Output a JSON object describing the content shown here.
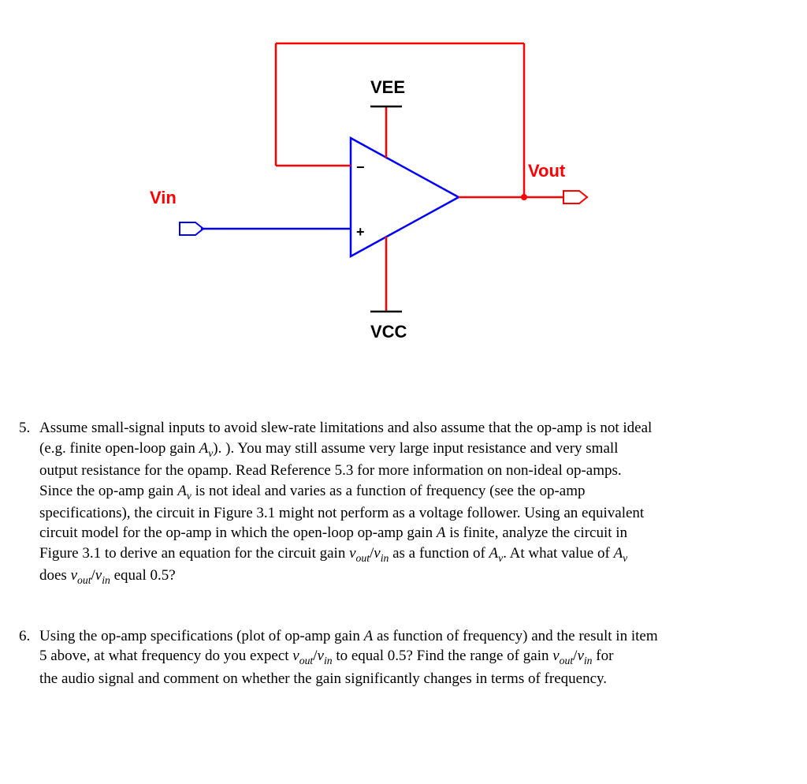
{
  "diagram": {
    "vee_label": "VEE",
    "vcc_label": "VCC",
    "vin_label": "Vin",
    "vout_label": "Vout",
    "plus_sign": "+",
    "minus_sign": "−"
  },
  "problem5": {
    "number": "5.",
    "line1": "Assume small-signal inputs to avoid slew-rate limitations and also assume that the op-amp is not ideal",
    "line2a": "(e.g. finite open-loop gain ",
    "line2_sym1": "A",
    "line2_sub1": "v",
    "line2b": "). ). You may still assume very large input resistance and very small",
    "line3": "output resistance for the opamp. Read Reference 5.3 for more information on non-ideal op-amps.",
    "line4a": "Since the op-amp gain ",
    "line4_sym1": "A",
    "line4_sub1": "v",
    "line4b": " is not ideal and varies as a function of frequency (see the op-amp",
    "line5": "specifications), the circuit in Figure 3.1 might not perform as a voltage follower.  Using an equivalent",
    "line6a": "circuit model for the op-amp in which the open-loop op-amp gain ",
    "line6_symA": "A",
    "line6b": " is finite, analyze the circuit in",
    "line7a": "Figure 3.1 to derive an equation for the circuit gain ",
    "line7_vout": "v",
    "line7_vout_sub": "out",
    "line7_slash": "/",
    "line7_vin": "v",
    "line7_vin_sub": "in",
    "line7b": " as a function of ",
    "line7_symA": "A",
    "line7_subv": "v",
    "line7c": ". At what value of ",
    "line7_symA2": "A",
    "line7_subv2": "v",
    "line8a": "does ",
    "line8_vout": "v",
    "line8_vout_sub": "out",
    "line8_slash": "/",
    "line8_vin": "v",
    "line8_vin_sub": "in",
    "line8b": " equal 0.5?"
  },
  "problem6": {
    "number": "6.",
    "line1a": "Using the op-amp specifications (plot of op-amp gain ",
    "line1_symA": "A",
    "line1b": " as function of frequency) and the result in item",
    "line2a": "5 above, at what frequency do you expect ",
    "line2_vout": "v",
    "line2_vout_sub": "out",
    "line2_slash": "/",
    "line2_vin": "v",
    "line2_vin_sub": "in",
    "line2b": " to equal 0.5? Find the range of gain ",
    "line2_vout2": "v",
    "line2_vout2_sub": "out",
    "line2_slash2": "/",
    "line2_vin2": "v",
    "line2_vin2_sub": "in",
    "line2c": " for",
    "line3": "the audio signal and comment on whether the gain significantly changes in terms of frequency."
  }
}
